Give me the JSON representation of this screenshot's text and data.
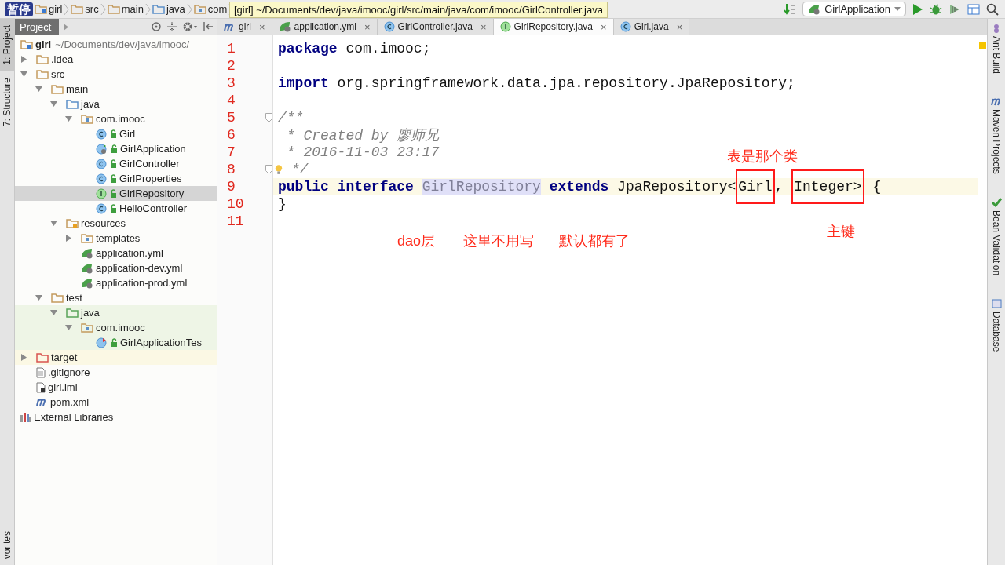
{
  "overlay_label": "暂停",
  "breadcrumbs": [
    {
      "label": "girl",
      "kind": "module"
    },
    {
      "label": "src",
      "kind": "folder"
    },
    {
      "label": "main",
      "kind": "folder"
    },
    {
      "label": "java",
      "kind": "source"
    },
    {
      "label": "com",
      "kind": "package"
    }
  ],
  "tooltip": "[girl] ~/Documents/dev/java/imooc/girl/src/main/java/com/imooc/GirlController.java",
  "run_config": {
    "label": "GirlApplication"
  },
  "left_strip": {
    "top": [
      {
        "label": "1: Project",
        "selected": true
      },
      {
        "label": "7: Structure",
        "selected": false
      }
    ],
    "bottom": [
      {
        "label": "vorites",
        "selected": false
      }
    ]
  },
  "project_panel": {
    "title": "Project"
  },
  "tree": [
    {
      "label": "girl",
      "path": "~/Documents/dev/java/imooc/",
      "kind": "module",
      "selected": false,
      "children": [
        {
          "label": ".idea",
          "kind": "folder",
          "expanded": false,
          "selected": false
        },
        {
          "label": "src",
          "kind": "folder",
          "expanded": true,
          "selected": false,
          "children": [
            {
              "label": "main",
              "kind": "folder",
              "expanded": true,
              "selected": false,
              "children": [
                {
                  "label": "java",
                  "kind": "source",
                  "expanded": true,
                  "selected": false,
                  "children": [
                    {
                      "label": "com.imooc",
                      "kind": "package",
                      "expanded": true,
                      "selected": false,
                      "children": [
                        {
                          "label": "Girl",
                          "kind": "class",
                          "selected": false
                        },
                        {
                          "label": "GirlApplication",
                          "kind": "app",
                          "selected": false
                        },
                        {
                          "label": "GirlController",
                          "kind": "class",
                          "selected": false
                        },
                        {
                          "label": "GirlProperties",
                          "kind": "class",
                          "selected": false
                        },
                        {
                          "label": "GirlRepository",
                          "kind": "interface",
                          "selected": true
                        },
                        {
                          "label": "HelloController",
                          "kind": "class",
                          "selected": false
                        }
                      ]
                    }
                  ]
                },
                {
                  "label": "resources",
                  "kind": "resources",
                  "expanded": true,
                  "selected": false,
                  "children": [
                    {
                      "label": "templates",
                      "kind": "package",
                      "expanded": false,
                      "selected": false
                    },
                    {
                      "label": "application.yml",
                      "kind": "yml",
                      "selected": false
                    },
                    {
                      "label": "application-dev.yml",
                      "kind": "yml",
                      "selected": false
                    },
                    {
                      "label": "application-prod.yml",
                      "kind": "yml",
                      "selected": false
                    }
                  ]
                }
              ]
            },
            {
              "label": "test",
              "kind": "folder",
              "expanded": true,
              "selected": false,
              "children": [
                {
                  "label": "java",
                  "kind": "test-source",
                  "expanded": true,
                  "selected": false,
                  "children": [
                    {
                      "label": "com.imooc",
                      "kind": "package",
                      "expanded": true,
                      "selected": false,
                      "children": [
                        {
                          "label": "GirlApplicationTes",
                          "kind": "test-class",
                          "selected": false
                        }
                      ]
                    }
                  ]
                }
              ]
            }
          ]
        },
        {
          "label": "target",
          "kind": "excluded",
          "expanded": false,
          "selected": false
        },
        {
          "label": ".gitignore",
          "kind": "text",
          "selected": false
        },
        {
          "label": "girl.iml",
          "kind": "iml",
          "selected": false
        },
        {
          "label": "pom.xml",
          "kind": "maven",
          "selected": false
        }
      ]
    },
    {
      "label": "External Libraries",
      "kind": "libraries",
      "selected": false
    }
  ],
  "tabs": [
    {
      "label": "girl",
      "kind": "maven",
      "close": "×",
      "selected": false
    },
    {
      "label": "application.yml",
      "kind": "yml",
      "close": "×",
      "selected": false
    },
    {
      "label": "GirlController.java",
      "kind": "class",
      "close": "×",
      "selected": false
    },
    {
      "label": "GirlRepository.java",
      "kind": "interface",
      "close": "×",
      "selected": true
    },
    {
      "label": "Girl.java",
      "kind": "class",
      "close": "×",
      "selected": false
    }
  ],
  "code_lines": [
    {
      "number": "1",
      "tokens": [
        {
          "text": "package",
          "kind": "keyword"
        },
        {
          "text": " com.imooc;",
          "kind": "plain"
        }
      ]
    },
    {
      "number": "2"
    },
    {
      "number": "3",
      "tokens": [
        {
          "text": "import",
          "kind": "keyword"
        },
        {
          "text": " org.springframework.data.jpa.repository.JpaRepository;",
          "kind": "plain"
        }
      ]
    },
    {
      "number": "4"
    },
    {
      "number": "5",
      "fold": true,
      "tokens": [
        {
          "text": "/**",
          "kind": "comment"
        }
      ]
    },
    {
      "number": "6",
      "tokens": [
        {
          "text": " * Created by 廖师兄",
          "kind": "comment"
        }
      ]
    },
    {
      "number": "7",
      "tokens": [
        {
          "text": " * 2016-11-03 23:17",
          "kind": "comment"
        }
      ]
    },
    {
      "number": "8",
      "fold": true,
      "bulb": true,
      "tokens": [
        {
          "text": " */",
          "kind": "comment"
        }
      ]
    },
    {
      "number": "9",
      "current": true,
      "tokens": [
        {
          "text": "public ",
          "kind": "keyword"
        },
        {
          "text": "interface ",
          "kind": "keyword"
        },
        {
          "text": "GirlRepository",
          "kind": "usage"
        },
        {
          "text": " extends",
          "kind": "keyword"
        },
        {
          "text": " JpaRepository<",
          "kind": "plain"
        },
        {
          "text": "Girl",
          "kind": "boxed"
        },
        {
          "text": ", ",
          "kind": "plain"
        },
        {
          "text": "Integer>",
          "kind": "boxed"
        },
        {
          "text": " {",
          "kind": "plain"
        }
      ]
    },
    {
      "number": "10",
      "tokens": [
        {
          "text": "}",
          "kind": "plain"
        }
      ]
    },
    {
      "number": "11"
    }
  ],
  "annotations": [
    {
      "text": "表是那个类"
    },
    {
      "text": "dao层"
    },
    {
      "text": "这里不用写"
    },
    {
      "text": "默认都有了"
    },
    {
      "text": "主键"
    }
  ],
  "right_strip": [
    {
      "label": "Ant Build",
      "kind": "ant"
    },
    {
      "label": "Maven Projects",
      "kind": "maven"
    },
    {
      "label": "Bean Validation",
      "kind": "bean"
    },
    {
      "label": "Database",
      "kind": "database"
    }
  ]
}
